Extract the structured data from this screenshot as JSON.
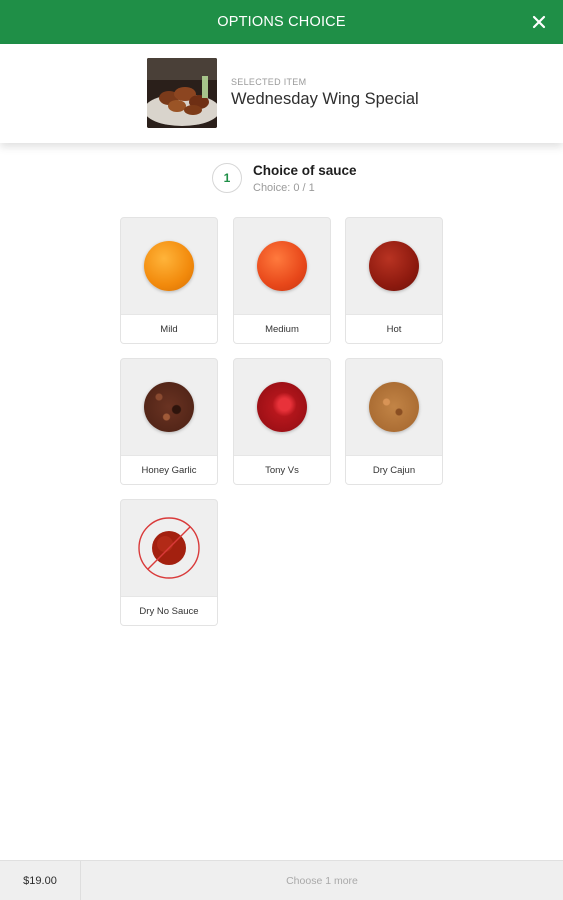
{
  "header": {
    "title": "OPTIONS CHOICE",
    "close_icon": "close-icon"
  },
  "selected": {
    "label": "SELECTED ITEM",
    "name": "Wednesday Wing Special"
  },
  "step": {
    "number": "1",
    "title": "Choice of sauce",
    "count": "Choice: 0 / 1"
  },
  "options": [
    {
      "label": "Mild",
      "color": "#f28a0c"
    },
    {
      "label": "Medium",
      "color": "#e8481a"
    },
    {
      "label": "Hot",
      "color": "#8e1a0f"
    },
    {
      "label": "Honey Garlic",
      "color": "#5b2a1c"
    },
    {
      "label": "Tony Vs",
      "color": "#b8141a"
    },
    {
      "label": "Dry Cajun",
      "color": "#b8753a"
    },
    {
      "label": "Dry No Sauce",
      "color": "#a3200f"
    }
  ],
  "footer": {
    "price": "$19.00",
    "action": "Choose 1 more"
  },
  "colors": {
    "brand": "#1f8f47",
    "no_sauce_ring": "#d93a3a"
  }
}
